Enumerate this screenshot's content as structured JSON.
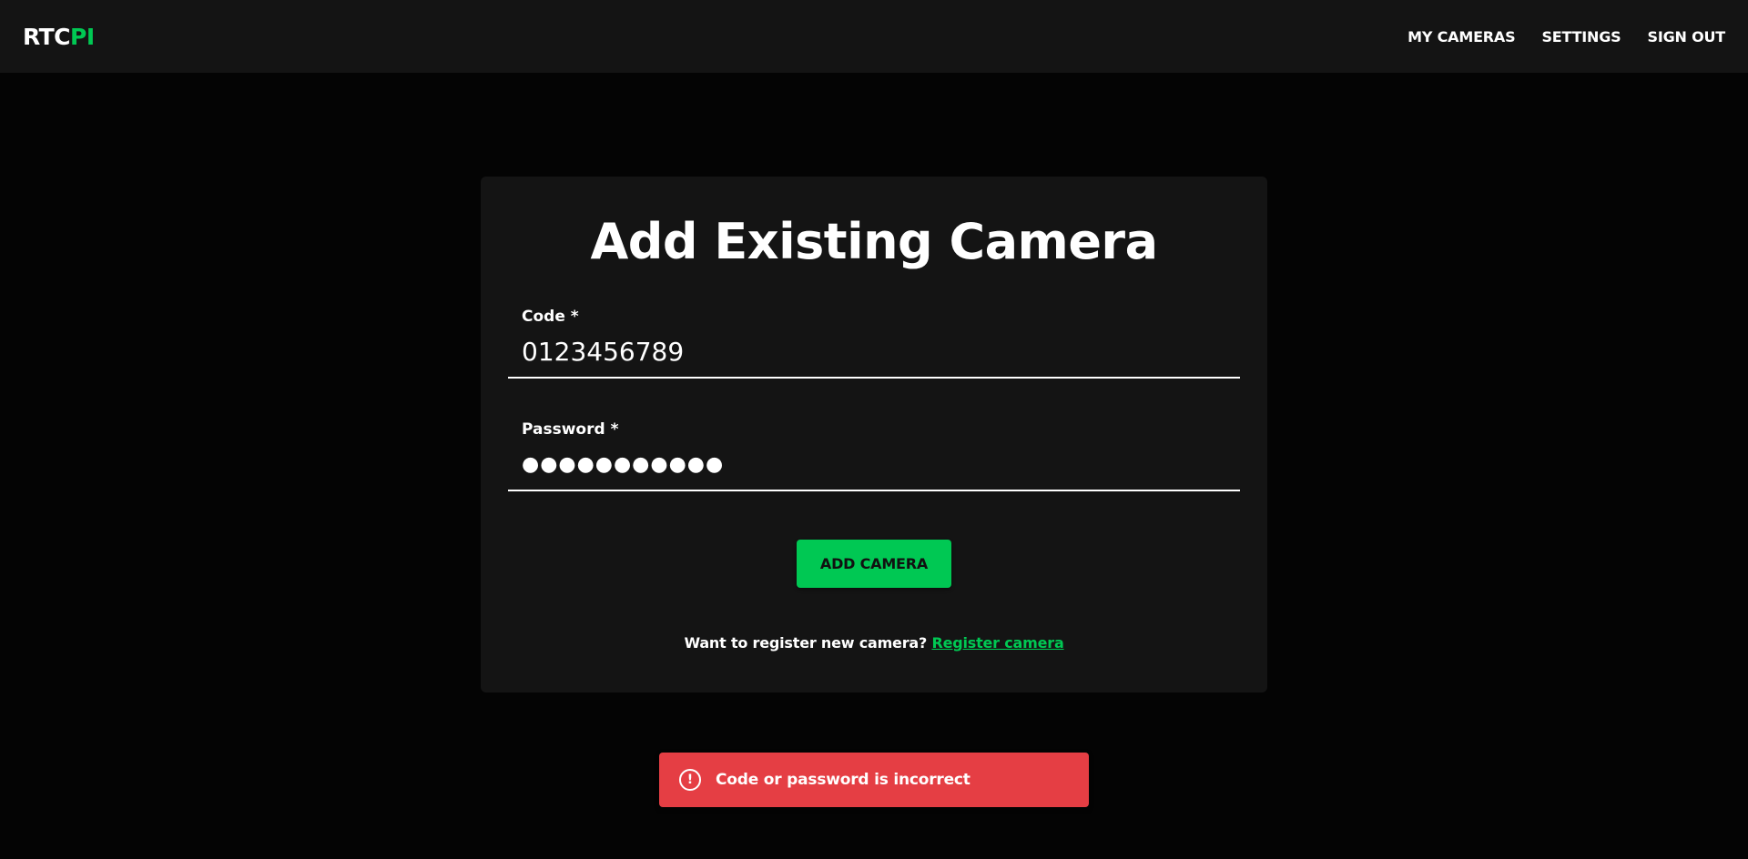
{
  "header": {
    "logo_part1": "RTC",
    "logo_part2": "PI",
    "nav": {
      "my_cameras": "MY CAMERAS",
      "settings": "SETTINGS",
      "sign_out": "SIGN OUT"
    }
  },
  "form": {
    "title": "Add Existing Camera",
    "code": {
      "label": "Code *",
      "value": "0123456789"
    },
    "password": {
      "label": "Password *",
      "value": "●●●●●●●●●●●"
    },
    "submit_label": "ADD CAMERA",
    "register_prompt": "Want to register new camera? ",
    "register_link": "Register camera"
  },
  "toast": {
    "icon": "alert-circle-icon",
    "icon_glyph": "!",
    "message": "Code or password is incorrect"
  },
  "colors": {
    "accent": "#00c853",
    "error": "#e53e44",
    "background": "#040404",
    "surface": "#141414"
  }
}
